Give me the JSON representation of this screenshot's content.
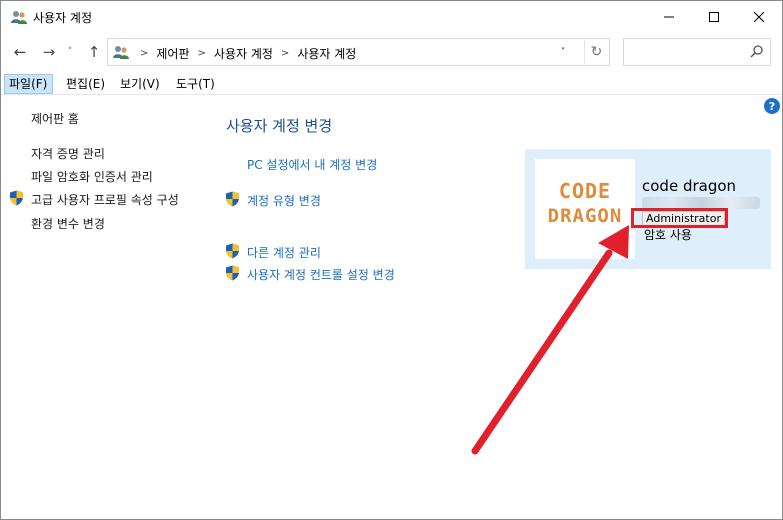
{
  "window": {
    "title": "사용자 계정",
    "icon": "users-icon",
    "controls": {
      "minimize": "minimize-icon",
      "maximize": "maximize-icon",
      "close": "close-icon"
    }
  },
  "nav": {
    "back": "←",
    "forward": "→",
    "recent": "˅",
    "up": "↑",
    "breadcrumbs": [
      "제어판",
      "사용자 계정",
      "사용자 계정"
    ],
    "separator": ">",
    "dropdown": "˅",
    "refresh": "↻",
    "search_placeholder": ""
  },
  "menu": [
    {
      "label": "파일(F)",
      "active": true
    },
    {
      "label": "편집(E)",
      "active": false
    },
    {
      "label": "보기(V)",
      "active": false
    },
    {
      "label": "도구(T)",
      "active": false
    }
  ],
  "help": "?",
  "left_pane": {
    "home": "제어판 홈",
    "links": [
      {
        "label": "자격 증명 관리",
        "shield": false
      },
      {
        "label": "파일 암호화 인증서 관리",
        "shield": false
      },
      {
        "label": "고급 사용자 프로필 속성 구성",
        "shield": true
      },
      {
        "label": "환경 변수 변경",
        "shield": false
      }
    ]
  },
  "main": {
    "title": "사용자 계정 변경",
    "tasks": [
      {
        "label": "PC 설정에서 내 계정 변경",
        "shield": false
      },
      {
        "label": "계정 유형 변경",
        "shield": true
      },
      {
        "label": "다른 계정 관리",
        "shield": true
      },
      {
        "label": "사용자 계정 컨트롤 설정 변경",
        "shield": true
      }
    ]
  },
  "account": {
    "avatar_line1": "CODE",
    "avatar_line2": "DRAGON",
    "name": "code dragon",
    "type": "Administrator",
    "password_status": "암호 사용"
  },
  "colors": {
    "accent_link": "#1a6ec0",
    "title_blue": "#1e4e8c",
    "card_bg": "#dfeefb",
    "highlight_red": "#e0202a",
    "avatar_orange": "#e08a3c"
  }
}
